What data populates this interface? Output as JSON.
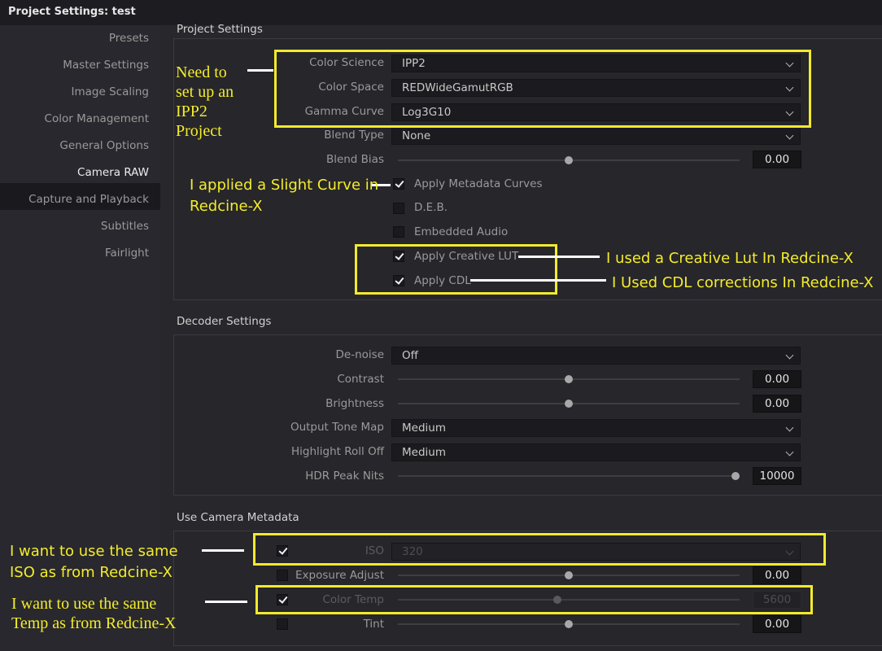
{
  "window": {
    "title": "Project Settings:  test"
  },
  "sidebar": {
    "items": [
      {
        "label": "Presets"
      },
      {
        "label": "Master Settings"
      },
      {
        "label": "Image Scaling"
      },
      {
        "label": "Color Management"
      },
      {
        "label": "General Options"
      },
      {
        "label": "Camera RAW"
      },
      {
        "label": "Capture and Playback"
      },
      {
        "label": "Subtitles"
      },
      {
        "label": "Fairlight"
      }
    ],
    "active": "Camera RAW"
  },
  "project_settings": {
    "title": "Project Settings",
    "color_science": {
      "label": "Color Science",
      "value": "IPP2"
    },
    "color_space": {
      "label": "Color Space",
      "value": "REDWideGamutRGB"
    },
    "gamma_curve": {
      "label": "Gamma Curve",
      "value": "Log3G10"
    },
    "blend_type": {
      "label": "Blend Type",
      "value": "None"
    },
    "blend_bias": {
      "label": "Blend Bias",
      "value": "0.00",
      "level": 0.5
    },
    "apply_metadata_curves": {
      "label": "Apply Metadata Curves",
      "checked": true
    },
    "deb": {
      "label": "D.E.B.",
      "checked": false
    },
    "embedded_audio": {
      "label": "Embedded Audio",
      "checked": false
    },
    "apply_creative_lut": {
      "label": "Apply Creative LUT",
      "checked": true
    },
    "apply_cdl": {
      "label": "Apply CDL",
      "checked": true
    }
  },
  "decoder_settings": {
    "title": "Decoder Settings",
    "denoise": {
      "label": "De-noise",
      "value": "Off"
    },
    "contrast": {
      "label": "Contrast",
      "value": "0.00",
      "level": 0.5
    },
    "brightness": {
      "label": "Brightness",
      "value": "0.00",
      "level": 0.5
    },
    "output_tone_map": {
      "label": "Output Tone Map",
      "value": "Medium"
    },
    "highlight_roll_off": {
      "label": "Highlight Roll Off",
      "value": "Medium"
    },
    "hdr_peak_nits": {
      "label": "HDR Peak Nits",
      "value": "10000",
      "level": 1.0
    }
  },
  "camera_metadata": {
    "title": "Use Camera Metadata",
    "iso": {
      "label": "ISO",
      "value": "320",
      "checked": true
    },
    "exposure_adjust": {
      "label": "Exposure Adjust",
      "value": "0.00",
      "checked": false,
      "level": 0.5
    },
    "color_temp": {
      "label": "Color Temp",
      "value": "5600",
      "checked": true
    },
    "tint": {
      "label": "Tint",
      "value": "0.00",
      "checked": false,
      "level": 0.5
    }
  },
  "annotations": {
    "ipp2": "Need to set up an IPP2 Project",
    "ipp2_lines": [
      "Need to",
      "set up an",
      "IPP2",
      "Project"
    ],
    "curve_lines": [
      "I applied a Slight Curve in",
      "Redcine-X"
    ],
    "lut": "I used a Creative Lut In Redcine-X",
    "cdl": "I Used CDL corrections In Redcine-X",
    "iso_lines": [
      "I want to use the same",
      "ISO as from Redcine-X"
    ],
    "temp_lines": [
      "I want to use the same",
      "Temp as from Redcine-X"
    ]
  },
  "colors": {
    "highlight": "#f3ea2e",
    "panel": "#27272c",
    "sidebar_active": "#1a1a1e"
  }
}
